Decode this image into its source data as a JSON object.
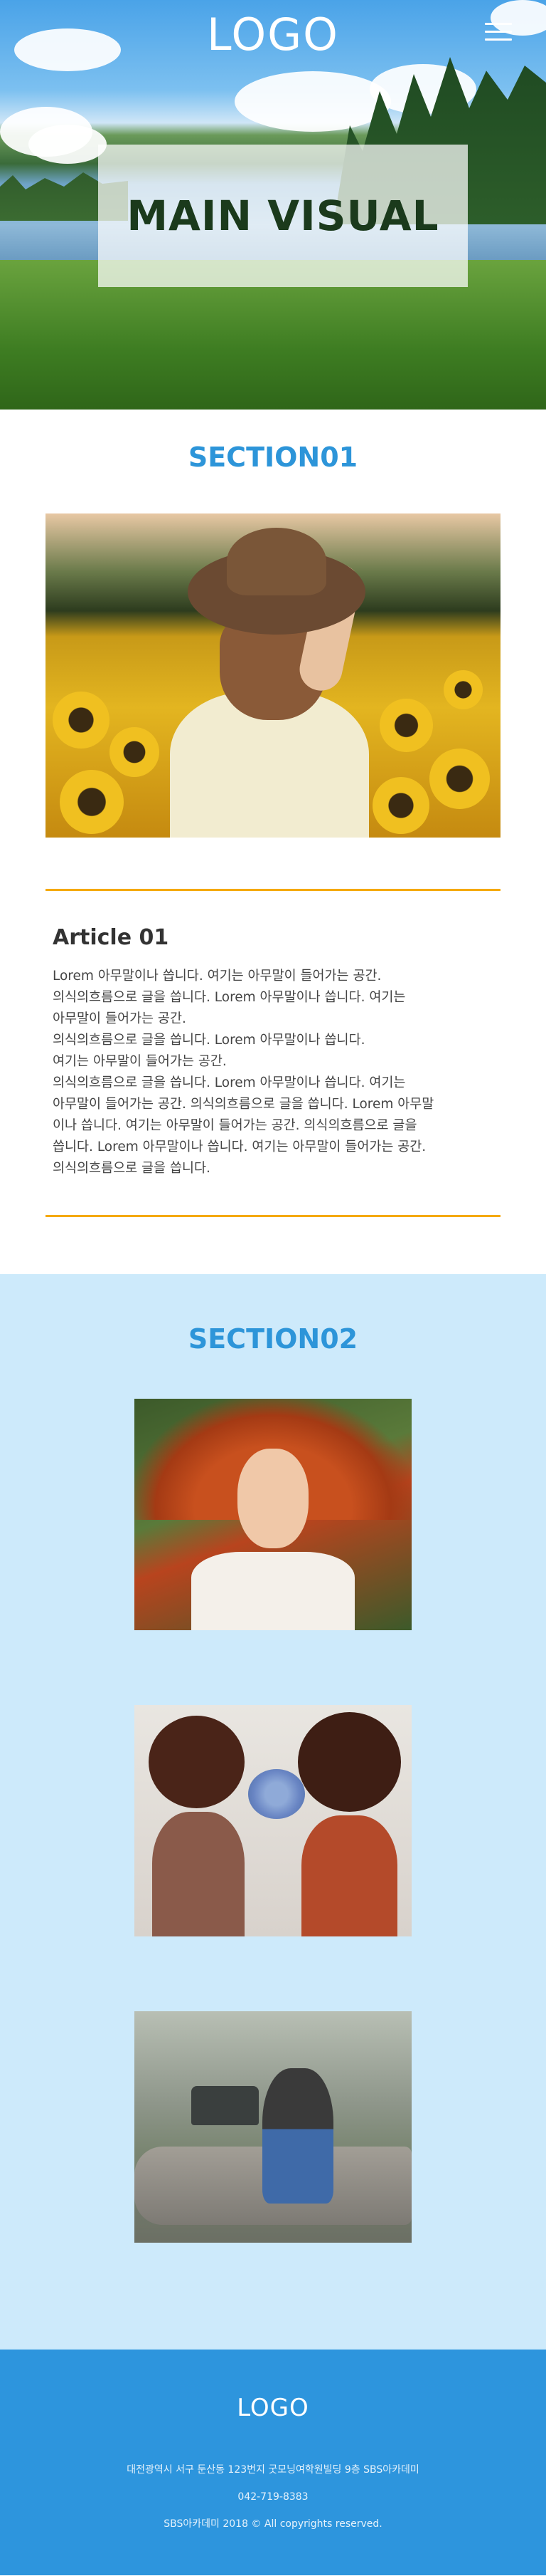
{
  "header": {
    "logo": "LOGO",
    "menu_icon": "hamburger-menu-icon"
  },
  "hero": {
    "main_visual": "MAIN VISUAL"
  },
  "section01": {
    "title": "SECTION01",
    "article": {
      "title": "Article 01",
      "lines": [
        "Lorem 아무말이나 씁니다. 여기는 아무말이 들어가는 공간.",
        "의식의흐름으로 글을 씁니다. Lorem 아무말이나 씁니다. 여기는",
        "아무말이 들어가는 공간.",
        "의식의흐름으로 글을 씁니다. Lorem 아무말이나 씁니다.",
        "여기는 아무말이 들어가는 공간.",
        "의식의흐름으로 글을 씁니다. Lorem 아무말이나 씁니다. 여기는",
        "아무말이 들어가는 공간. 의식의흐름으로 글을 씁니다. Lorem 아무말",
        "이나 씁니다. 여기는 아무말이 들어가는 공간. 의식의흐름으로 글을",
        "씁니다. Lorem 아무말이나 씁니다. 여기는 아무말이 들어가는 공간.",
        "의식의흐름으로 글을 씁니다."
      ]
    }
  },
  "section02": {
    "title": "SECTION02"
  },
  "footer": {
    "logo": "LOGO",
    "address": "대전광역시 서구 둔산동 123번지 굿모닝여학원빌딩 9층 SBS아카데미",
    "phone": "042-719-8383",
    "copyright": "SBS아카데미 2018 © All copyrights reserved."
  },
  "colors": {
    "accent_blue": "#2d95d9",
    "divider_orange": "#f5a90b",
    "section02_bg": "#cdeafb",
    "footer_bg": "#2d95dd"
  }
}
